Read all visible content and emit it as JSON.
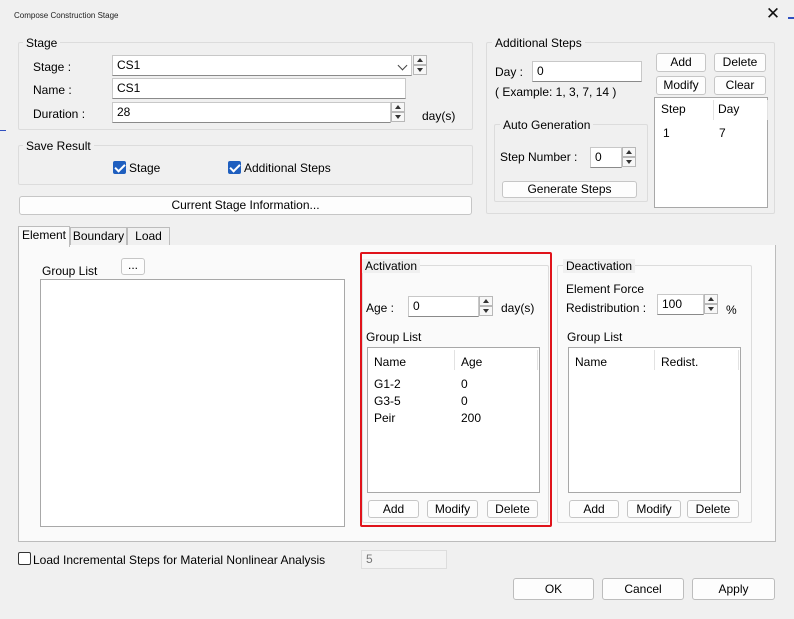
{
  "window": {
    "title": "Compose Construction Stage",
    "close_label": "✕"
  },
  "stage": {
    "group_title": "Stage",
    "stage_label": "Stage :",
    "stage_value": "CS1",
    "name_label": "Name :",
    "name_value": "CS1",
    "duration_label": "Duration :",
    "duration_value": "28",
    "duration_unit": "day(s)"
  },
  "save_result": {
    "group_title": "Save Result",
    "stage_label": "Stage",
    "additional_steps_label": "Additional Steps"
  },
  "current_stage_info_label": "Current Stage Information...",
  "additional_steps": {
    "group_title": "Additional Steps",
    "day_label": "Day :",
    "day_value": "0",
    "example_text": "( Example: 1, 3, 7, 14  )",
    "add_label": "Add",
    "delete_label": "Delete",
    "modify_label": "Modify",
    "clear_label": "Clear",
    "table": {
      "columns": [
        "Step",
        "Day"
      ],
      "rows": [
        [
          "1",
          "7"
        ]
      ]
    },
    "auto_generation": {
      "group_title": "Auto Generation",
      "step_number_label": "Step Number  :",
      "step_number_value": "0",
      "generate_label": "Generate Steps"
    }
  },
  "tabs": [
    {
      "label": "Element"
    },
    {
      "label": "Boundary"
    },
    {
      "label": "Load"
    }
  ],
  "element_tab": {
    "group_list_label": "Group List",
    "more_button_label": "...",
    "activation": {
      "group_title": "Activation",
      "age_label": "Age  :",
      "age_value": "0",
      "age_unit": "day(s)",
      "group_list_label": "Group List",
      "columns": [
        "Name",
        "Age"
      ],
      "rows": [
        [
          "G1-2",
          "0"
        ],
        [
          "G3-5",
          "0"
        ],
        [
          "Peir",
          "200"
        ]
      ],
      "add_label": "Add",
      "modify_label": "Modify",
      "delete_label": "Delete"
    },
    "deactivation": {
      "group_title": "Deactivation",
      "element_force_label": "Element Force",
      "redistribution_label": "Redistribution  :",
      "redistribution_value": "100",
      "redistribution_unit": "%",
      "group_list_label": "Group List",
      "columns": [
        "Name",
        "Redist."
      ],
      "rows": [],
      "add_label": "Add",
      "modify_label": "Modify",
      "delete_label": "Delete"
    }
  },
  "load_incremental": {
    "label": "Load Incremental Steps for Material Nonlinear Analysis",
    "value": "5"
  },
  "footer": {
    "ok_label": "OK",
    "cancel_label": "Cancel",
    "apply_label": "Apply"
  },
  "colors": {
    "highlight_border": "#e0131b",
    "checkbox_checked": "#1f5fbf"
  }
}
